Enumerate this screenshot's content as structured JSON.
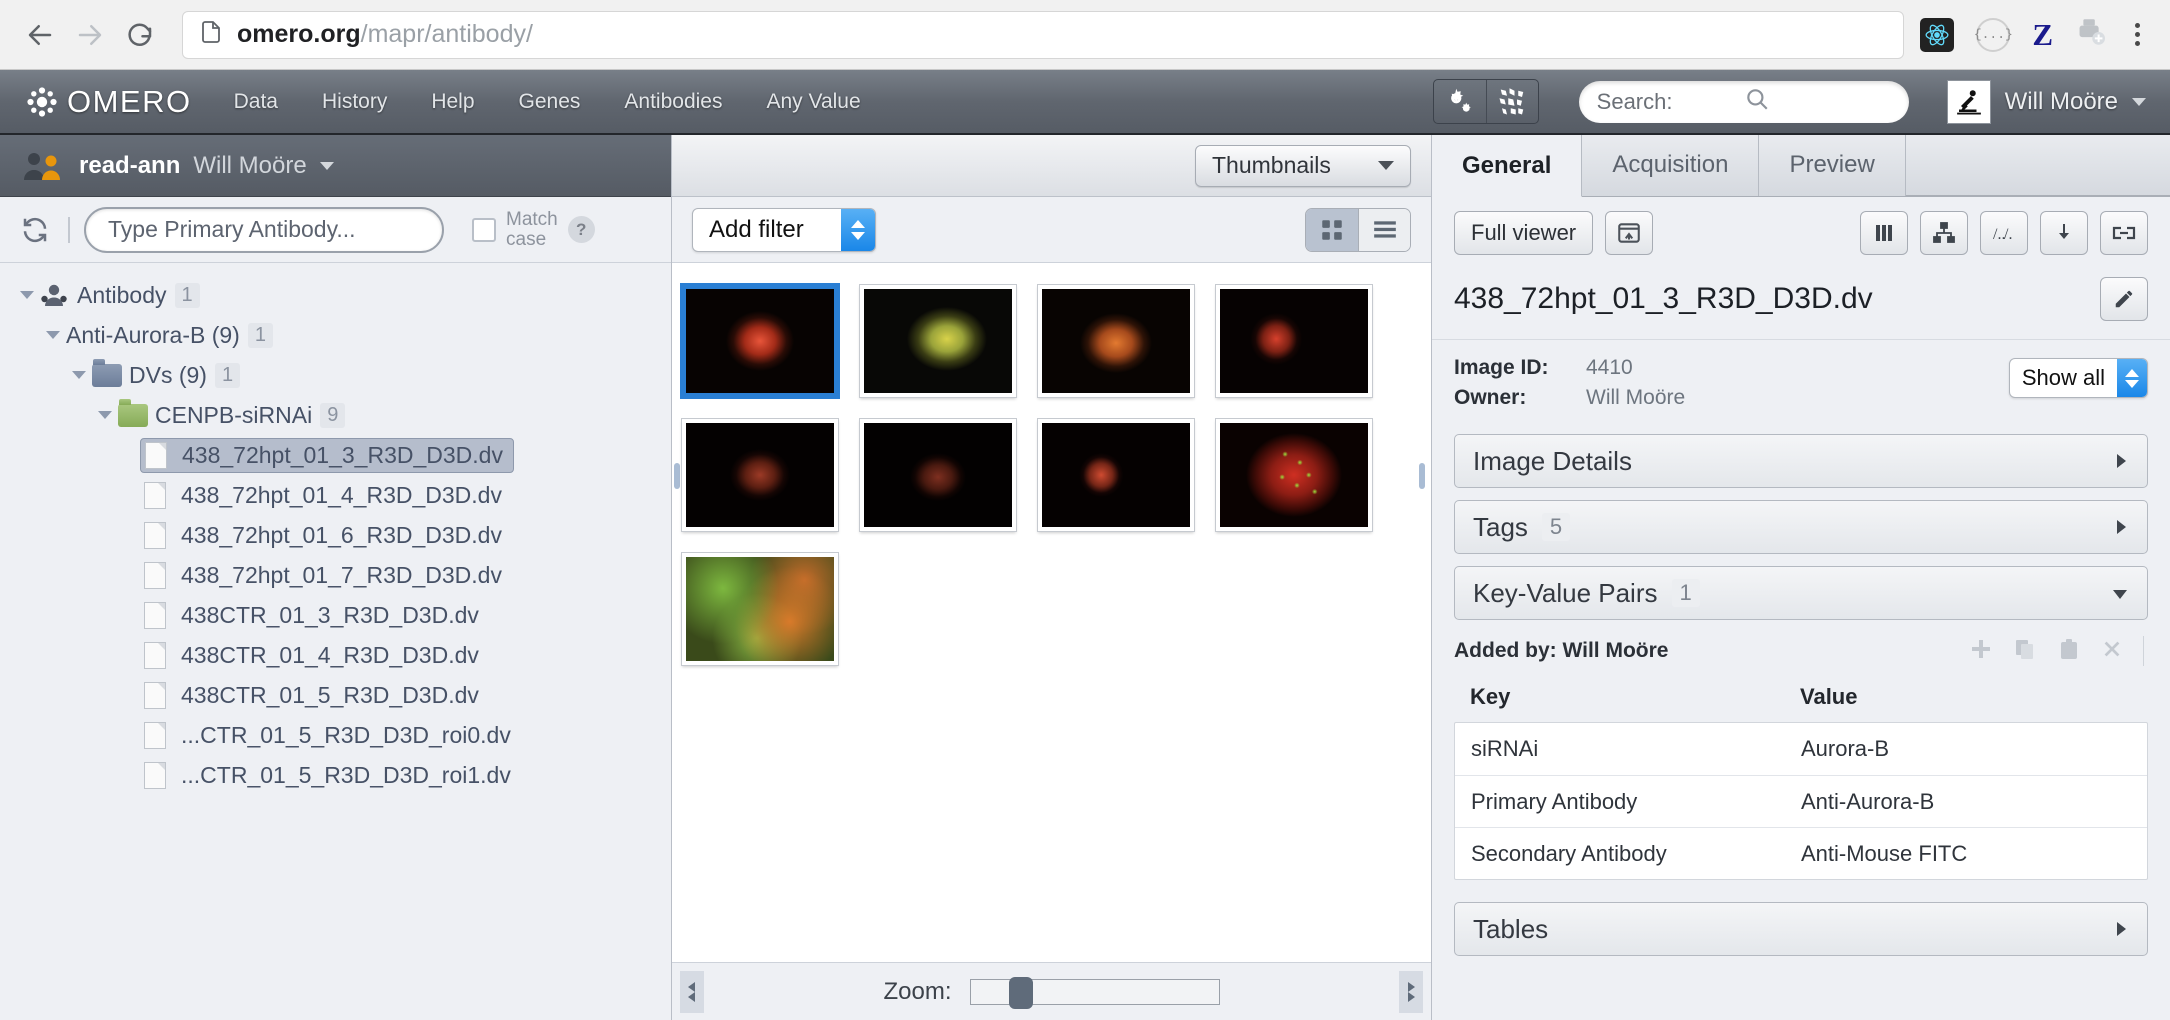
{
  "browser": {
    "url_domain": "omero.org",
    "url_path": "/mapr/antibody/",
    "extensions": [
      {
        "name": "react-devtools-icon"
      },
      {
        "name": "json-viewer-icon",
        "label": "{...}"
      },
      {
        "name": "zotero-icon",
        "label": "Z"
      },
      {
        "name": "print-icon"
      },
      {
        "name": "chrome-menu-icon"
      }
    ]
  },
  "header": {
    "logo_text": "OMERO",
    "nav": [
      "Data",
      "History",
      "Help",
      "Genes",
      "Antibodies",
      "Any Value"
    ],
    "search_placeholder": "Search:",
    "user_name": "Will Moöre"
  },
  "left": {
    "group_name": "read-ann",
    "group_user": "Will Moöre",
    "filter_placeholder": "Type Primary Antibody...",
    "match_case_line1": "Match",
    "match_case_line2": "case",
    "help_label": "?",
    "tree": [
      {
        "label": "Antibody",
        "badge": "1",
        "depth": 0,
        "icon": "user-icon",
        "twisty": true,
        "selected": false
      },
      {
        "label": "Anti-Aurora-B (9)",
        "badge": "1",
        "depth": 1,
        "icon": "none",
        "twisty": true,
        "selected": false
      },
      {
        "label": "DVs (9)",
        "badge": "1",
        "depth": 2,
        "icon": "folder-blue",
        "twisty": true,
        "selected": false
      },
      {
        "label": "CENPB-siRNAi",
        "badge": "9",
        "depth": 3,
        "icon": "folder-green",
        "twisty": true,
        "selected": false
      },
      {
        "label": "438_72hpt_01_3_R3D_D3D.dv",
        "badge": "",
        "depth": 4,
        "icon": "file",
        "twisty": false,
        "selected": true
      },
      {
        "label": "438_72hpt_01_4_R3D_D3D.dv",
        "badge": "",
        "depth": 4,
        "icon": "file",
        "twisty": false,
        "selected": false
      },
      {
        "label": "438_72hpt_01_6_R3D_D3D.dv",
        "badge": "",
        "depth": 4,
        "icon": "file",
        "twisty": false,
        "selected": false
      },
      {
        "label": "438_72hpt_01_7_R3D_D3D.dv",
        "badge": "",
        "depth": 4,
        "icon": "file",
        "twisty": false,
        "selected": false
      },
      {
        "label": "438CTR_01_3_R3D_D3D.dv",
        "badge": "",
        "depth": 4,
        "icon": "file",
        "twisty": false,
        "selected": false
      },
      {
        "label": "438CTR_01_4_R3D_D3D.dv",
        "badge": "",
        "depth": 4,
        "icon": "file",
        "twisty": false,
        "selected": false
      },
      {
        "label": "438CTR_01_5_R3D_D3D.dv",
        "badge": "",
        "depth": 4,
        "icon": "file",
        "twisty": false,
        "selected": false
      },
      {
        "label": "...CTR_01_5_R3D_D3D_roi0.dv",
        "badge": "",
        "depth": 4,
        "icon": "file",
        "twisty": false,
        "selected": false
      },
      {
        "label": "...CTR_01_5_R3D_D3D_roi1.dv",
        "badge": "",
        "depth": 4,
        "icon": "file",
        "twisty": false,
        "selected": false
      }
    ]
  },
  "center": {
    "view_mode": "Thumbnails",
    "add_filter": "Add filter",
    "zoom_label": "Zoom:",
    "zoom_value": 17,
    "thumbnails": [
      {
        "id": 1,
        "selected": true,
        "style": "red-nucleus"
      },
      {
        "id": 2,
        "selected": false,
        "style": "yellow-green-nucleus"
      },
      {
        "id": 3,
        "selected": false,
        "style": "orange-nucleus"
      },
      {
        "id": 4,
        "selected": false,
        "style": "red-double"
      },
      {
        "id": 5,
        "selected": false,
        "style": "dim-red-nucleus"
      },
      {
        "id": 6,
        "selected": false,
        "style": "faint-red-nucleus"
      },
      {
        "id": 7,
        "selected": false,
        "style": "two-red-nuclei"
      },
      {
        "id": 8,
        "selected": false,
        "style": "spindle-green-dots"
      },
      {
        "id": 9,
        "selected": false,
        "style": "green-orange-texture"
      }
    ]
  },
  "right": {
    "tabs": [
      {
        "label": "General",
        "active": true
      },
      {
        "label": "Acquisition",
        "active": false
      },
      {
        "label": "Preview",
        "active": false
      }
    ],
    "full_viewer_label": "Full viewer",
    "image_title": "438_72hpt_01_3_R3D_D3D.dv",
    "meta": [
      {
        "key": "Image ID:",
        "value": "4410"
      },
      {
        "key": "Owner:",
        "value": "Will Moöre"
      }
    ],
    "show_all": "Show all",
    "accordions": [
      {
        "label": "Image Details",
        "badge": "",
        "expanded": false
      },
      {
        "label": "Tags",
        "badge": "5",
        "expanded": false
      },
      {
        "label": "Key-Value Pairs",
        "badge": "1",
        "expanded": true
      }
    ],
    "kv_added_by": "Added by: Will Moöre",
    "kv_columns": [
      "Key",
      "Value"
    ],
    "kv_rows": [
      {
        "key": "siRNAi",
        "value": "Aurora-B"
      },
      {
        "key": "Primary Antibody",
        "value": "Anti-Aurora-B"
      },
      {
        "key": "Secondary Antibody",
        "value": "Anti-Mouse FITC"
      }
    ],
    "tables_label": "Tables"
  }
}
